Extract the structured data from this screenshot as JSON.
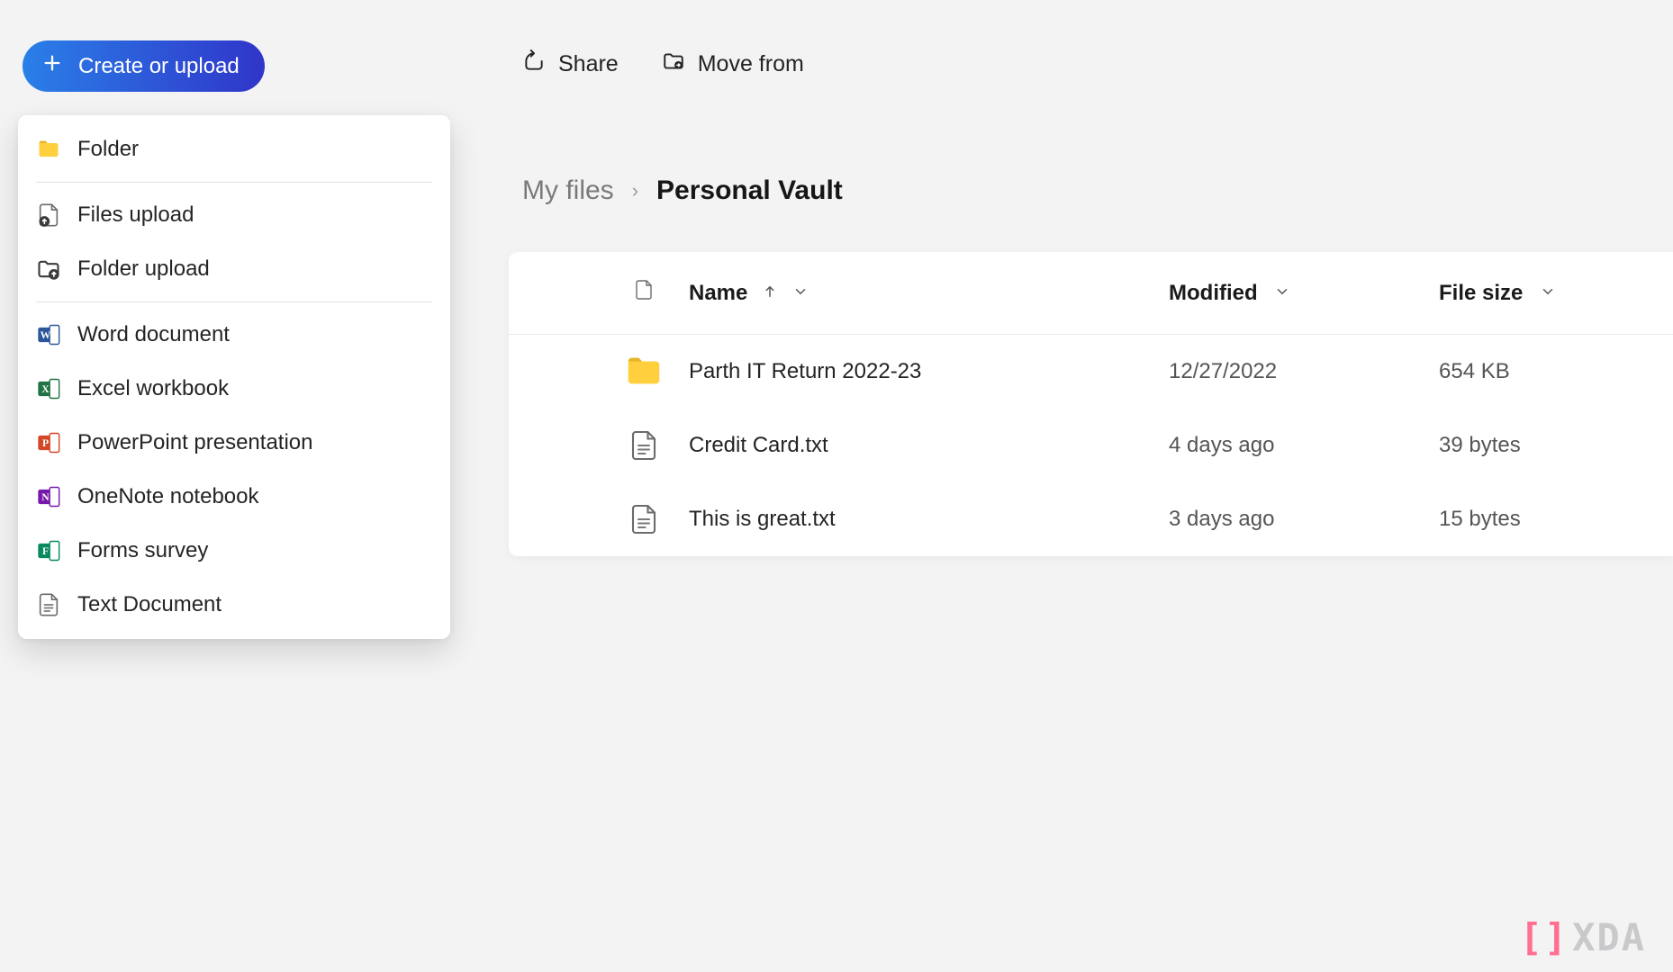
{
  "create_button": {
    "label": "Create or upload"
  },
  "dropdown": {
    "groups": [
      [
        {
          "label": "Folder",
          "icon": "folder"
        }
      ],
      [
        {
          "label": "Files upload",
          "icon": "file-upload"
        },
        {
          "label": "Folder upload",
          "icon": "folder-upload"
        }
      ],
      [
        {
          "label": "Word document",
          "icon": "word"
        },
        {
          "label": "Excel workbook",
          "icon": "excel"
        },
        {
          "label": "PowerPoint presentation",
          "icon": "powerpoint"
        },
        {
          "label": "OneNote notebook",
          "icon": "onenote"
        },
        {
          "label": "Forms survey",
          "icon": "forms"
        },
        {
          "label": "Text Document",
          "icon": "text"
        }
      ]
    ]
  },
  "toolbar": {
    "share": "Share",
    "move_from": "Move from"
  },
  "breadcrumb": {
    "root": "My files",
    "current": "Personal Vault"
  },
  "grid": {
    "headers": {
      "name": "Name",
      "modified": "Modified",
      "file_size": "File size"
    },
    "sort": {
      "column": "name",
      "dir": "asc"
    },
    "rows": [
      {
        "icon": "folder",
        "name": "Parth IT Return 2022-23",
        "modified": "12/27/2022",
        "size": "654 KB"
      },
      {
        "icon": "text",
        "name": "Credit Card.txt",
        "modified": "4 days ago",
        "size": "39 bytes"
      },
      {
        "icon": "text",
        "name": "This is great.txt",
        "modified": "3 days ago",
        "size": "15 bytes"
      }
    ]
  },
  "watermark": "XDA"
}
